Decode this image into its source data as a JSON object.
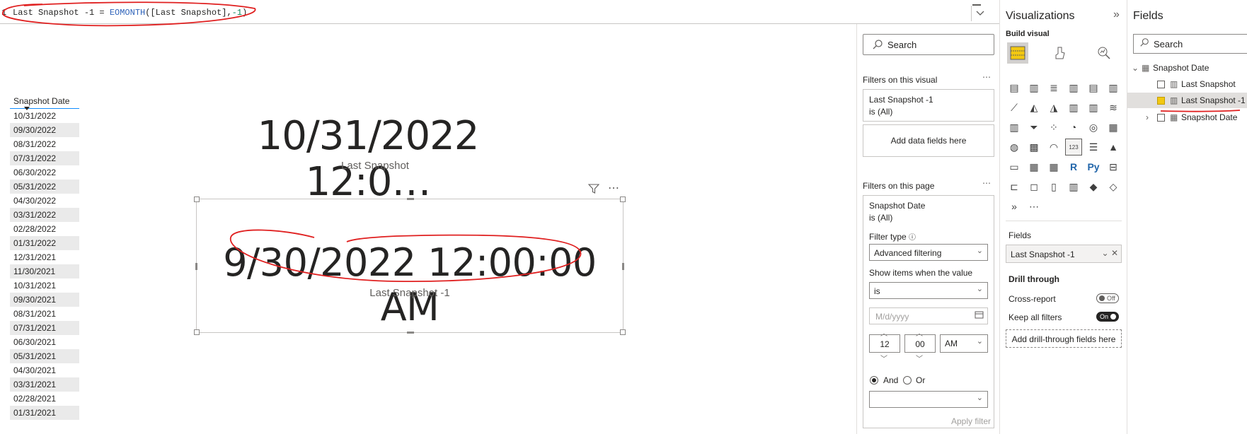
{
  "formula_bar": {
    "line_number": "1",
    "measure_name": "Last Snapshot -1 = ",
    "function_name": "EOMONTH",
    "args_part": "([Last Snapshot],",
    "arg_number": "-1",
    "closing": ")",
    "expand_icon": "chevron-down-icon"
  },
  "table_visual": {
    "header": "Snapshot Date",
    "rows": [
      "10/31/2022",
      "09/30/2022",
      "08/31/2022",
      "07/31/2022",
      "06/30/2022",
      "05/31/2022",
      "04/30/2022",
      "03/31/2022",
      "02/28/2022",
      "01/31/2022",
      "12/31/2021",
      "11/30/2021",
      "10/31/2021",
      "09/30/2021",
      "08/31/2021",
      "07/31/2021",
      "06/30/2021",
      "05/31/2021",
      "04/30/2021",
      "03/31/2021",
      "02/28/2021",
      "01/31/2021"
    ]
  },
  "card_last_snapshot": {
    "value": "10/31/2022 12:0…",
    "label": "Last Snapshot"
  },
  "card_last_snapshot_minus1": {
    "value": "9/30/2022 12:00:00 AM",
    "label": "Last Snapshot -1"
  },
  "filters": {
    "search_placeholder": "Search",
    "on_visual_title": "Filters on this visual",
    "visual_filter_field": "Last Snapshot -1",
    "visual_filter_state": "is (All)",
    "add_data_fields": "Add data fields here",
    "on_page_title": "Filters on this page",
    "page_filter_field": "Snapshot Date",
    "page_filter_state": "is (All)",
    "filter_type_label": "Filter type",
    "filter_type_value": "Advanced filtering",
    "show_items_label": "Show items when the value",
    "condition_value": "is",
    "date_placeholder": "M/d/yyyy",
    "hour": "12",
    "minute": "00",
    "ampm": "AM",
    "and_label": "And",
    "or_label": "Or",
    "apply_filter": "Apply filter"
  },
  "visualizations": {
    "title": "Visualizations",
    "build_visual": "Build visual",
    "fields_label": "Fields",
    "field_well_value": "Last Snapshot -1",
    "drill_through": "Drill through",
    "cross_report": "Cross-report",
    "cross_report_state": "Off",
    "keep_all_filters": "Keep all filters",
    "keep_all_filters_state": "On",
    "add_drill_fields": "Add drill-through fields here",
    "icon_text_r": "R",
    "icon_text_py": "Py"
  },
  "fields_pane": {
    "title": "Fields",
    "search_placeholder": "Search",
    "table_name": "Snapshot Date",
    "field_1": "Last Snapshot",
    "field_2": "Last Snapshot -1",
    "field_3": "Snapshot Date"
  },
  "colors": {
    "accent": "#118dff",
    "annotation": "#e02020",
    "check": "#f2c811"
  }
}
